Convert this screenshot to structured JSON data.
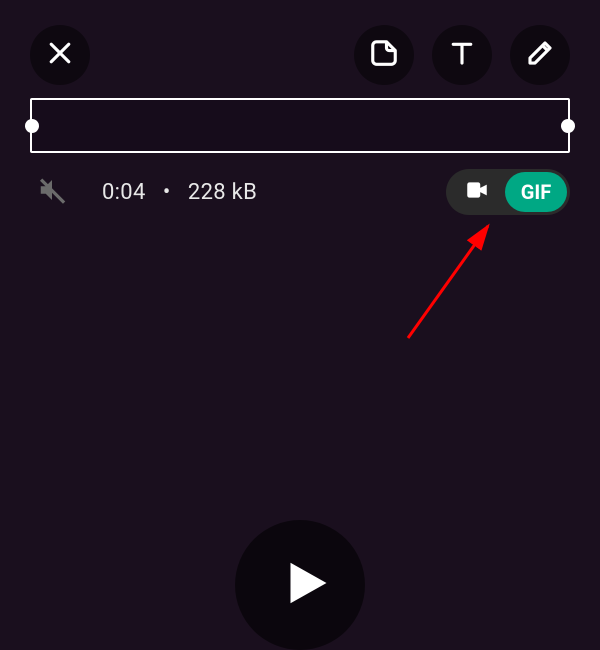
{
  "toolbar": {
    "close": "Close",
    "sticker": "Sticker",
    "text": "Text",
    "draw": "Draw"
  },
  "meta": {
    "duration": "0:04",
    "separator": "•",
    "filesize": "228 kB"
  },
  "toggle": {
    "video": "Video",
    "gif": "GIF"
  },
  "controls": {
    "mute": "Muted",
    "play": "Play"
  },
  "colors": {
    "accent": "#00a884"
  }
}
